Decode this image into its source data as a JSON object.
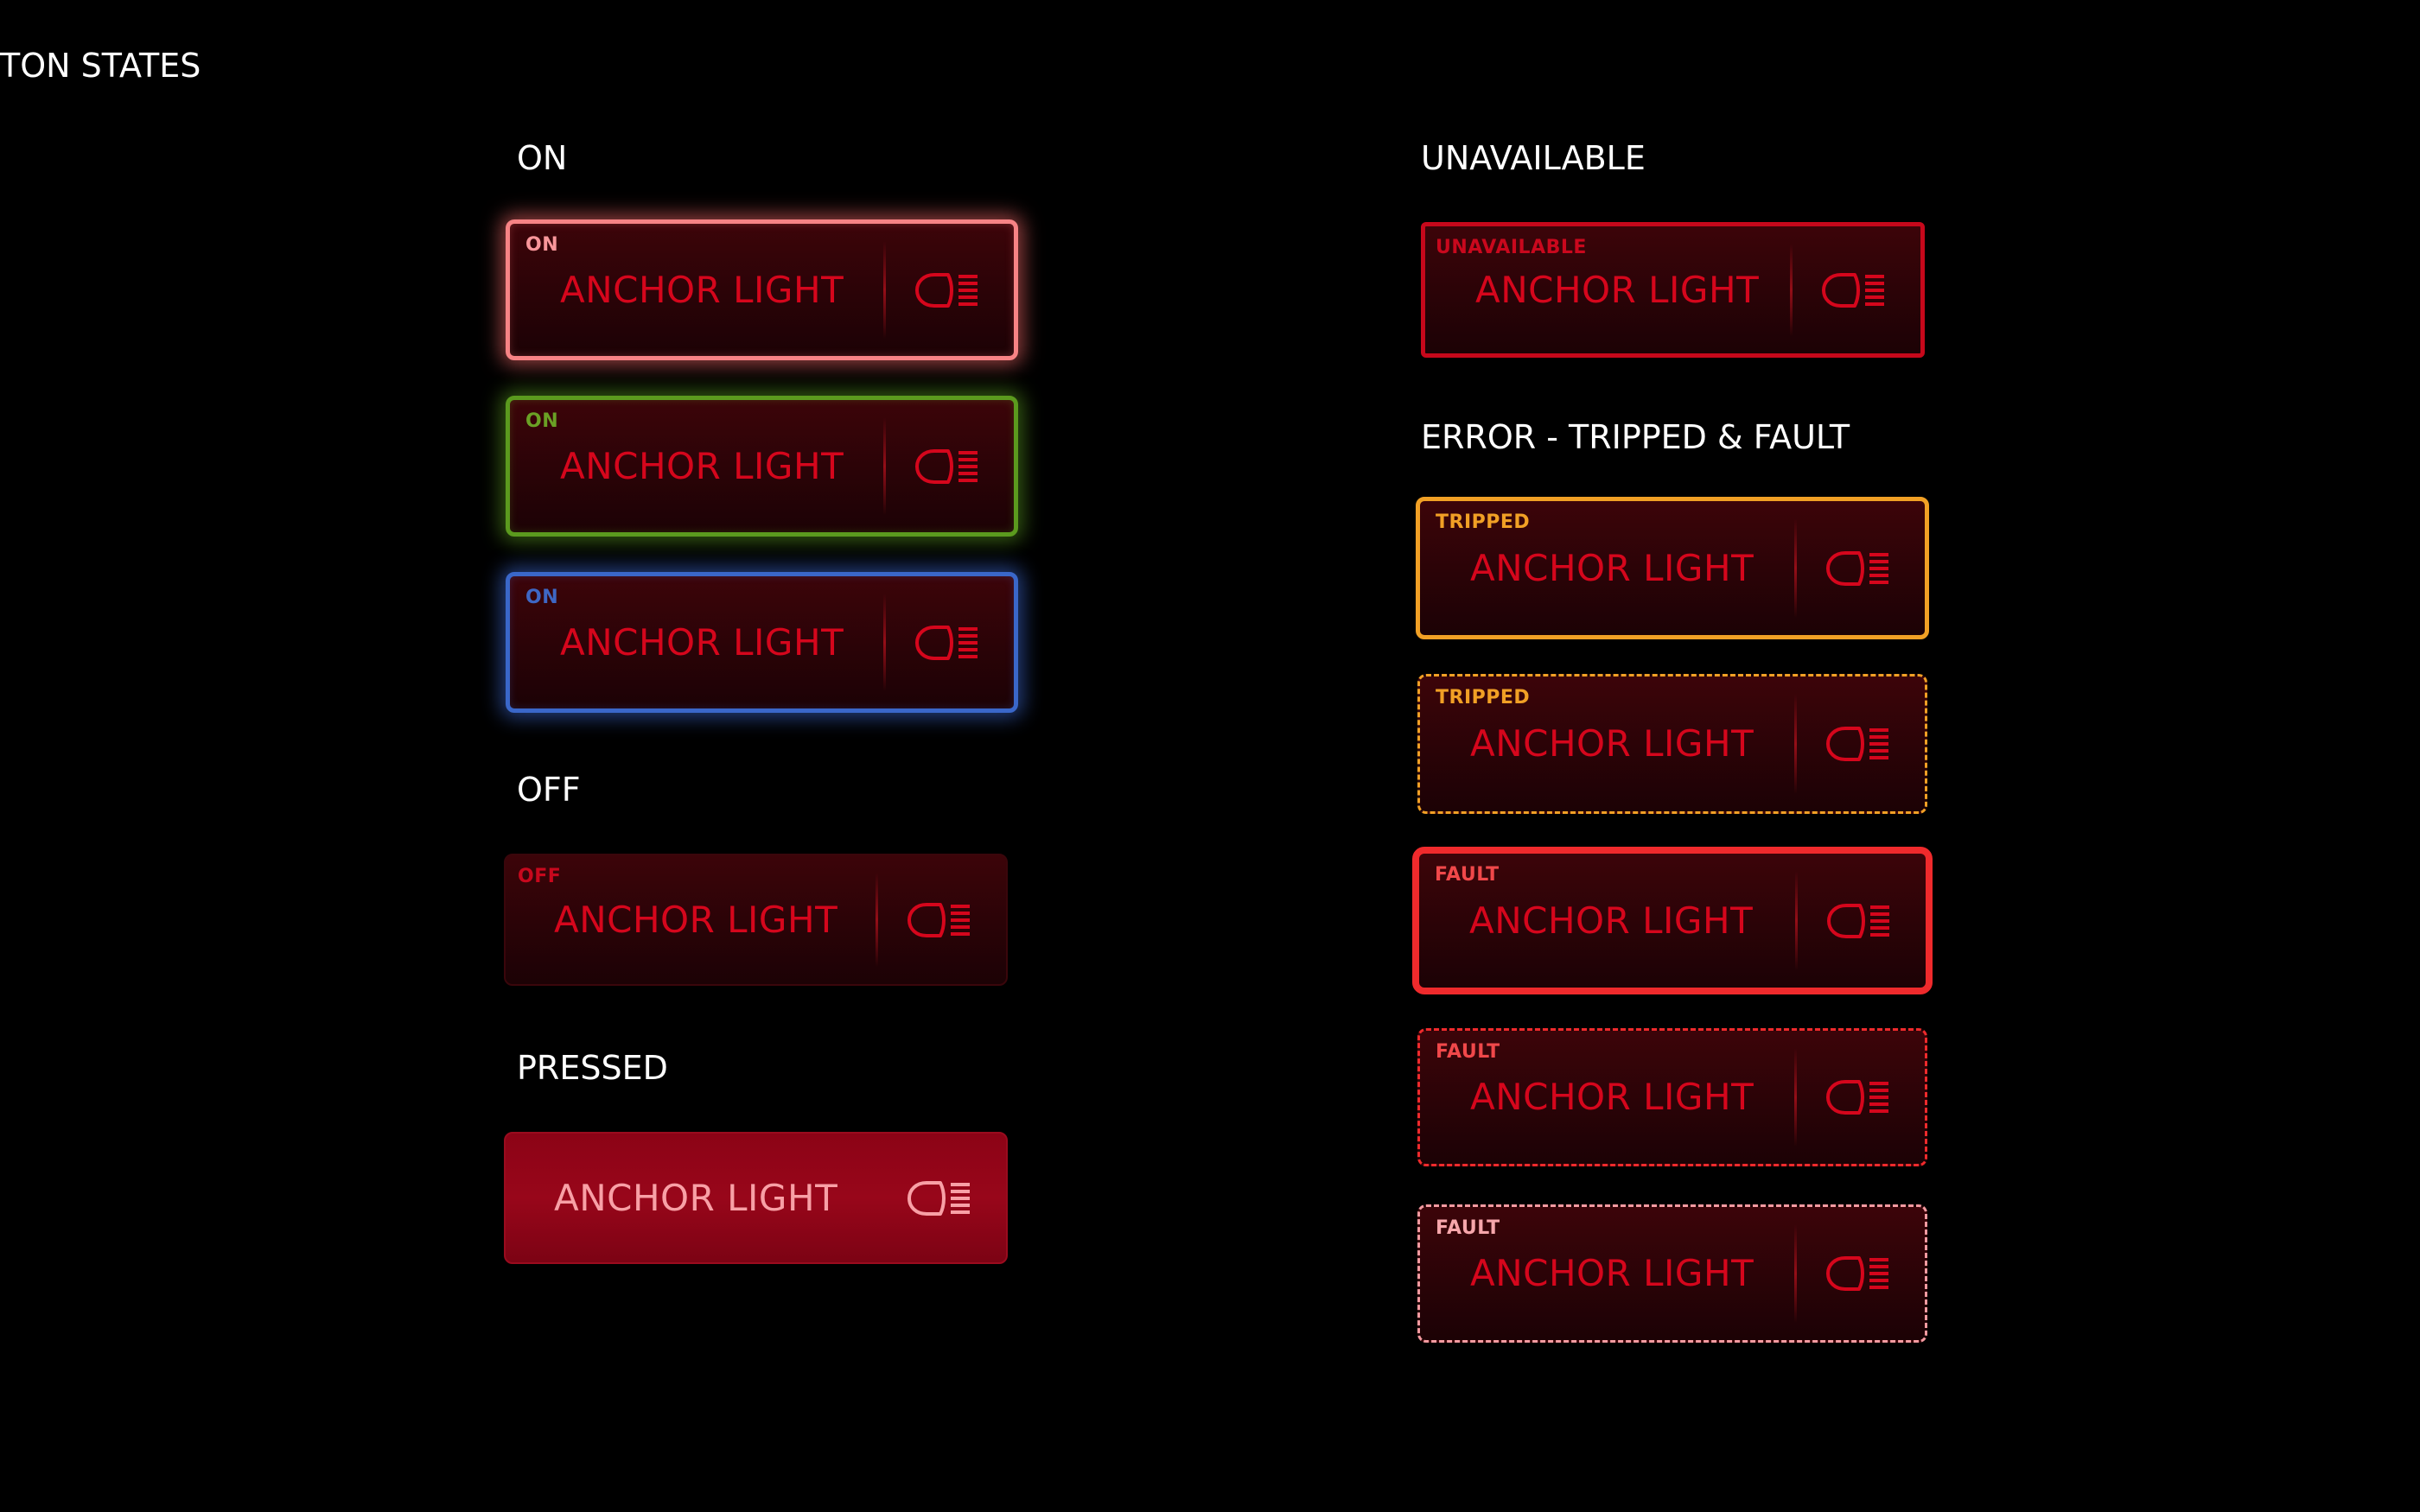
{
  "page": {
    "title": "TON STATES"
  },
  "sections": {
    "on": "ON",
    "off": "OFF",
    "pressed": "PRESSED",
    "unavailable": "UNAVAILABLE",
    "error": "ERROR - TRIPPED & FAULT"
  },
  "buttons": [
    {
      "tag": "ON",
      "label": "ANCHOR LIGHT",
      "icon": "headlight-icon",
      "border_color": "#f78385"
    },
    {
      "tag": "ON",
      "label": "ANCHOR LIGHT",
      "icon": "headlight-icon",
      "border_color": "#5b9a1e"
    },
    {
      "tag": "ON",
      "label": "ANCHOR LIGHT",
      "icon": "headlight-icon",
      "border_color": "#3a67c9"
    },
    {
      "tag": "OFF",
      "label": "ANCHOR LIGHT",
      "icon": "headlight-icon",
      "border_color": "#3a060b"
    },
    {
      "tag": "",
      "label": "ANCHOR LIGHT",
      "icon": "headlight-icon",
      "border_color": "#9a0b1e"
    },
    {
      "tag": "UNAVAILABLE",
      "label": "ANCHOR LIGHT",
      "icon": "headlight-icon",
      "border_color": "#c6081b"
    },
    {
      "tag": "TRIPPED",
      "label": "ANCHOR LIGHT",
      "icon": "headlight-icon",
      "border_color": "#f1a025"
    },
    {
      "tag": "TRIPPED",
      "label": "ANCHOR LIGHT",
      "icon": "headlight-icon",
      "border_color": "#f1a025"
    },
    {
      "tag": "FAULT",
      "label": "ANCHOR LIGHT",
      "icon": "headlight-icon",
      "border_color": "#ef2a2c"
    },
    {
      "tag": "FAULT",
      "label": "ANCHOR LIGHT",
      "icon": "headlight-icon",
      "border_color": "#ef2a2c"
    },
    {
      "tag": "FAULT",
      "label": "ANCHOR LIGHT",
      "icon": "headlight-icon",
      "border_color": "#f49aa0"
    }
  ],
  "colors": {
    "background": "#000000",
    "label_red": "#d5061c",
    "pressed_label": "#f8a0a6"
  }
}
